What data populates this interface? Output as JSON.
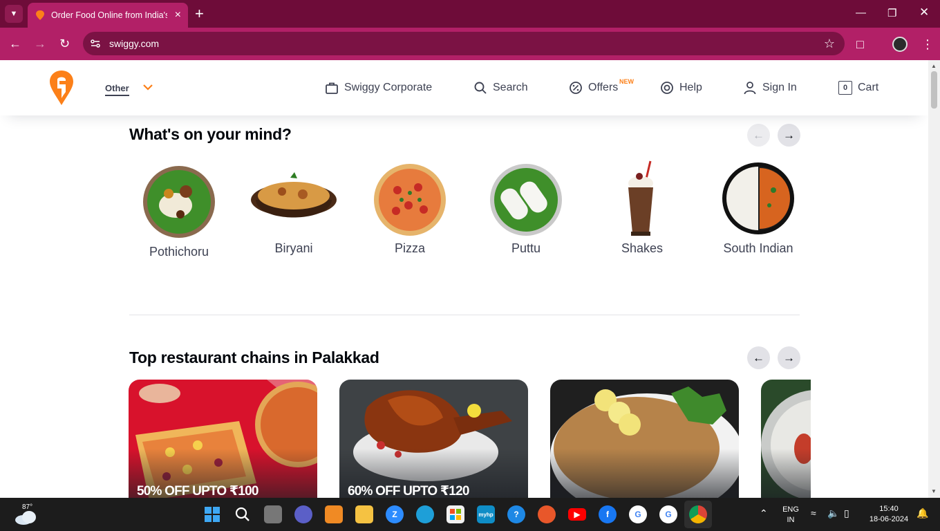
{
  "browser": {
    "tab_title": "Order Food Online from India's",
    "url": "swiggy.com"
  },
  "header": {
    "location_label": "Other",
    "nav": {
      "corporate": "Swiggy Corporate",
      "search": "Search",
      "offers": "Offers",
      "offers_badge": "NEW",
      "help": "Help",
      "sign_in": "Sign In",
      "cart": "Cart",
      "cart_count": "0"
    }
  },
  "mind_section": {
    "title": "What's on your mind?",
    "items": [
      {
        "label": "Pothichoru"
      },
      {
        "label": "Biryani"
      },
      {
        "label": "Pizza"
      },
      {
        "label": "Puttu"
      },
      {
        "label": "Shakes"
      },
      {
        "label": "South Indian"
      }
    ]
  },
  "chains_section": {
    "title": "Top restaurant chains in Palakkad",
    "cards": [
      {
        "offer": "50% OFF UPTO ₹100"
      },
      {
        "offer": "60% OFF UPTO ₹120"
      },
      {
        "offer": ""
      },
      {
        "offer": ""
      }
    ]
  },
  "taskbar": {
    "temperature": "87°",
    "lang_line1": "ENG",
    "lang_line2": "IN",
    "time": "15:40",
    "date": "18-06-2024"
  },
  "colors": {
    "brand": "#fc8019",
    "chrome_dark": "#6e0c39",
    "chrome_tab": "#b22067"
  }
}
